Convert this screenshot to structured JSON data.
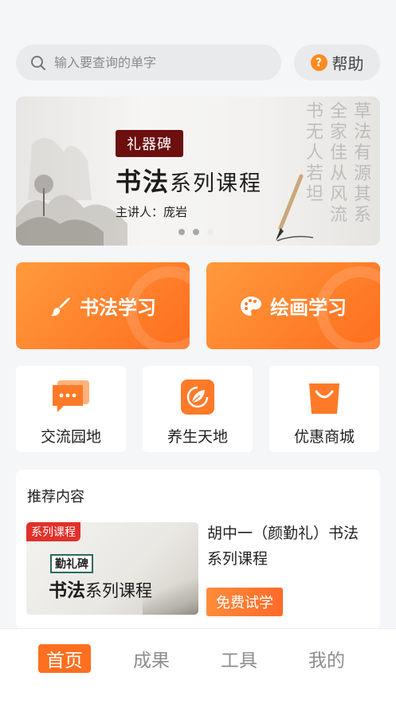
{
  "search": {
    "placeholder": "输入要查询的单字"
  },
  "help": {
    "label": "帮助"
  },
  "banner": {
    "tag": "礼器碑",
    "title_main": "书法",
    "title_rest": "系列课程",
    "speaker": "主讲人：庞岩",
    "calligraphy": "草法有源其系全家佳从风流书无人若坦",
    "slides": 3,
    "active_slide": 3
  },
  "big_buttons": [
    {
      "label": "书法学习",
      "icon": "brush-icon"
    },
    {
      "label": "绘画学习",
      "icon": "palette-icon"
    }
  ],
  "tiles": [
    {
      "label": "交流园地",
      "icon": "chat-icon"
    },
    {
      "label": "养生天地",
      "icon": "leaf-icon"
    },
    {
      "label": "优惠商城",
      "icon": "shopping-bag-icon"
    }
  ],
  "recommend": {
    "title": "推荐内容",
    "thumb_corner": "系列课程",
    "thumb_tag": "勤礼碑",
    "thumb_title_main": "书法",
    "thumb_title_rest": "系列课程",
    "course_title": "胡中一（颜勤礼）书法系列课程",
    "badge": "免费试学"
  },
  "tabs": [
    {
      "label": "首页",
      "active": true
    },
    {
      "label": "成果",
      "active": false
    },
    {
      "label": "工具",
      "active": false
    },
    {
      "label": "我的",
      "active": false
    }
  ],
  "colors": {
    "accent": "#ff6f1f",
    "tag_dark_red": "#6b0f0f",
    "corner_red": "#e1312a"
  }
}
